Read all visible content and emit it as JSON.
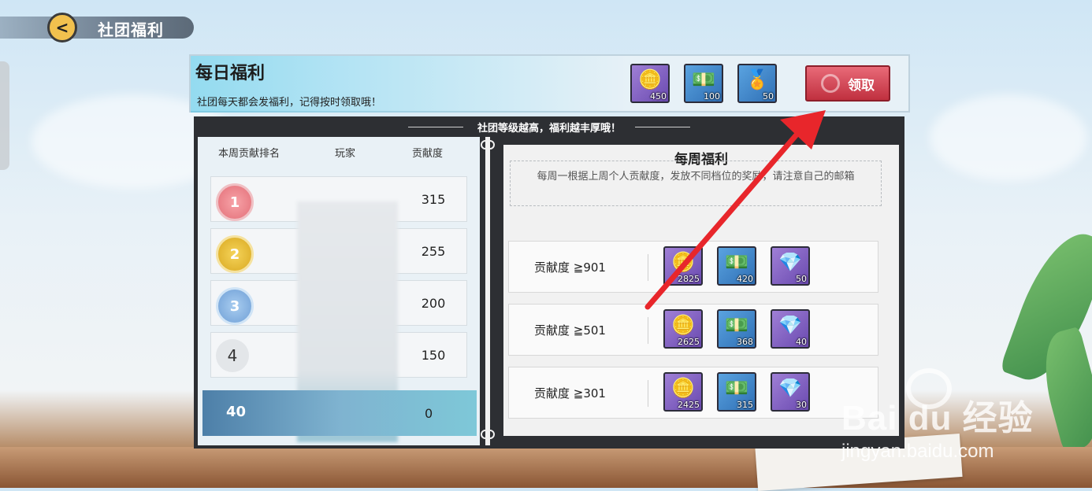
{
  "header": {
    "title": "社团福利",
    "back_glyph": "<"
  },
  "daily": {
    "title": "每日福利",
    "desc": "社团每天都会发福利，记得按时领取哦！",
    "rewards": [
      {
        "icon": "silver-coins-icon",
        "glyph": "🪙",
        "qty": "450",
        "color": "purple"
      },
      {
        "icon": "cash-stack-icon",
        "glyph": "💵",
        "qty": "100",
        "color": "blue"
      },
      {
        "icon": "medal-icon",
        "glyph": "🏅",
        "qty": "50",
        "color": "blue"
      }
    ],
    "claim_label": "领取"
  },
  "banner": "社团等级越高，福利越丰厚哦！",
  "ranking": {
    "headers": {
      "rank": "本周贡献排名",
      "player": "玩家",
      "contribution": "贡献度"
    },
    "rows": [
      {
        "rank": "1",
        "score": "315"
      },
      {
        "rank": "2",
        "score": "255"
      },
      {
        "rank": "3",
        "score": "200"
      },
      {
        "rank": "4",
        "score": "150"
      }
    ],
    "my_row": {
      "rank": "40",
      "score": "0"
    }
  },
  "weekly": {
    "title": "每周福利",
    "desc": "每周一根据上周个人贡献度，发放不同档位的奖励，请注意自己的邮箱",
    "tiers": [
      {
        "label": "贡献度 ≧901",
        "rewards": [
          "2825",
          "420",
          "50"
        ]
      },
      {
        "label": "贡献度 ≧501",
        "rewards": [
          "2625",
          "368",
          "40"
        ]
      },
      {
        "label": "贡献度 ≧301",
        "rewards": [
          "2425",
          "315",
          "30"
        ]
      }
    ],
    "reward_icons": [
      {
        "icon": "silver-coins-icon",
        "glyph": "🪙"
      },
      {
        "icon": "cash-stack-icon",
        "glyph": "💵"
      },
      {
        "icon": "diamond-icon",
        "glyph": "💎"
      }
    ]
  },
  "watermark": {
    "logo": "Bai du 经验",
    "url": "jingyan.baidu.com"
  },
  "colors": {
    "claim": "#c0303f",
    "arrow": "#e8262b",
    "frame": "#2d2f33"
  }
}
